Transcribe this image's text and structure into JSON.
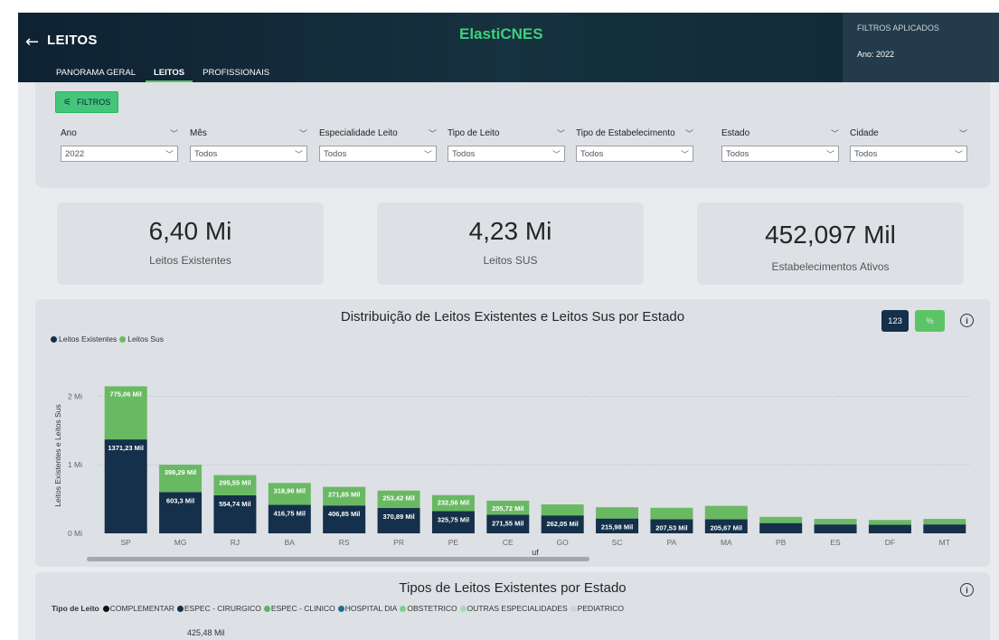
{
  "header": {
    "title": "LEITOS",
    "brand": "ElastiCNES",
    "tabs": [
      {
        "label": "PANORAMA GERAL",
        "active": false
      },
      {
        "label": "LEITOS",
        "active": true
      },
      {
        "label": "PROFISSIONAIS",
        "active": false
      }
    ],
    "filters_applied": {
      "title": "FILTROS APLICADOS",
      "value": "Ano: 2022"
    }
  },
  "filters": {
    "button_label": "FILTROS",
    "slicers": [
      {
        "label": "Ano",
        "value": "2022"
      },
      {
        "label": "Mês",
        "value": "Todos"
      },
      {
        "label": "Especialidade Leito",
        "value": "Todos"
      },
      {
        "label": "Tipo de Leito",
        "value": "Todos"
      },
      {
        "label": "Tipo de Estabelecimento",
        "value": "Todos"
      },
      {
        "label": "Estado",
        "value": "Todos"
      },
      {
        "label": "Cidade",
        "value": "Todos"
      }
    ]
  },
  "kpis": [
    {
      "value": "6,40 Mi",
      "label": "Leitos Existentes"
    },
    {
      "value": "4,23 Mi",
      "label": "Leitos SUS"
    },
    {
      "value": "452,097 Mil",
      "label": "Estabelecimentos Ativos"
    }
  ],
  "distribution_chart": {
    "title": "Distribuição de Leitos Existentes e Leitos Sus por Estado",
    "btn_count": "123",
    "btn_percent": "%",
    "info": "i"
  },
  "colors": {
    "existentes": "#14304a",
    "sus": "#69b963",
    "accent": "#5cc466"
  },
  "chart_data": {
    "type": "bar",
    "stacked": true,
    "categories": [
      "SP",
      "MG",
      "RJ",
      "BA",
      "RS",
      "PR",
      "PE",
      "CE",
      "GO",
      "SC",
      "PA",
      "MA",
      "PB",
      "ES",
      "DF",
      "MT"
    ],
    "series": [
      {
        "name": "Leitos Existentes",
        "values": [
          1371.23,
          603.3,
          554.74,
          416.75,
          406.85,
          370.89,
          325.75,
          271.55,
          262.05,
          215.98,
          207.53,
          205.67,
          150,
          130,
          125,
          130
        ],
        "labels": [
          "1371,23 Mil",
          "603,3 Mil",
          "554,74 Mil",
          "416,75 Mil",
          "406,85 Mil",
          "370,89 Mil",
          "325,75 Mil",
          "271,55 Mil",
          "262,05 Mil",
          "215,98 Mil",
          "207,53 Mil",
          "205,67 Mil",
          "",
          "",
          "",
          ""
        ]
      },
      {
        "name": "Leitos Sus",
        "values": [
          775.06,
          398.29,
          295.55,
          318.96,
          271.85,
          253.42,
          232.56,
          205.72,
          160,
          165,
          165,
          195,
          90,
          80,
          70,
          80
        ],
        "labels": [
          "775,06 Mil",
          "398,29 Mil",
          "295,55 Mil",
          "318,96 Mil",
          "271,85 Mil",
          "253,42 Mil",
          "232,56 Mil",
          "205,72 Mil",
          "",
          "",
          "",
          "",
          "",
          "",
          "",
          ""
        ]
      }
    ],
    "unit": "Mil",
    "yticks": [
      "0 Mi",
      "1 Mi",
      "2 Mi"
    ],
    "ytick_values": [
      0,
      1000,
      2000
    ],
    "ylim": [
      0,
      2270
    ],
    "xlabel": "uf",
    "ylabel": "Leitos Existentes e Leitos Sus",
    "legend_position": "top-left",
    "grid": true
  },
  "types_panel": {
    "title": "Tipos de Leitos Existentes por Estado",
    "legend_title": "Tipo de Leito",
    "legend": [
      {
        "name": "COMPLEMENTAR",
        "color": "#111111"
      },
      {
        "name": "ESPEC - CIRURGICO",
        "color": "#14304a"
      },
      {
        "name": "ESPEC - CLINICO",
        "color": "#5cb85c"
      },
      {
        "name": "HOSPITAL DIA",
        "color": "#1f6e8c"
      },
      {
        "name": "OBSTETRICO",
        "color": "#7ccf8c"
      },
      {
        "name": "OUTRAS ESPECIALIDADES",
        "color": "#a8dbb4"
      },
      {
        "name": "PEDIATRICO",
        "color": "#c9d3d8"
      }
    ],
    "top_label": "425,48 Mil",
    "info": "i"
  }
}
